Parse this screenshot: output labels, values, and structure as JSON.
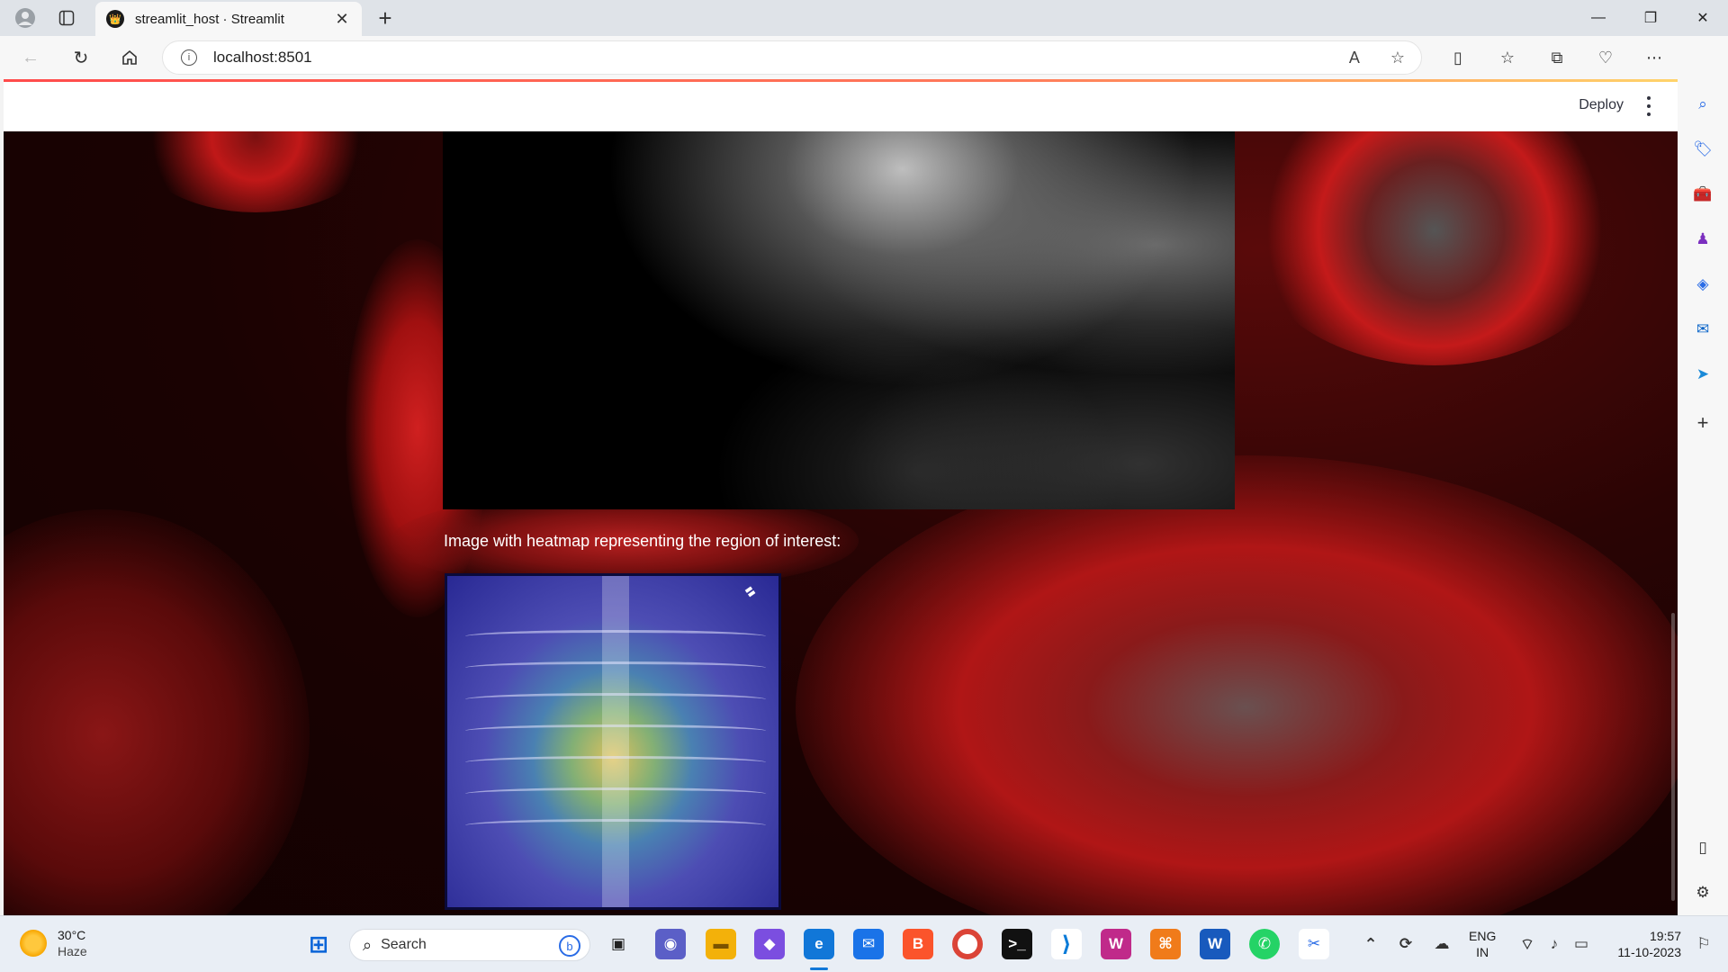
{
  "browser": {
    "tab_title": "streamlit_host · Streamlit",
    "url": "localhost:8501"
  },
  "page": {
    "deploy_label": "Deploy",
    "heatmap_caption": "Image with heatmap representing the region of interest:"
  },
  "taskbar": {
    "weather_temp": "30°C",
    "weather_desc": "Haze",
    "search_label": "Search",
    "lang_primary": "ENG",
    "lang_secondary": "IN",
    "time": "19:57",
    "date": "11-10-2023"
  },
  "colors": {
    "accent": "#ff4b4b",
    "background_dark": "#1a0202"
  },
  "icons": {
    "titlebar": [
      "profile-icon",
      "tab-actions-icon",
      "new-tab-icon",
      "minimize-icon",
      "restore-icon",
      "close-icon"
    ],
    "nav": [
      "back-icon",
      "refresh-icon",
      "home-icon",
      "site-info-icon",
      "read-aloud-icon",
      "favorite-star-icon",
      "split-screen-icon",
      "favorites-icon",
      "collections-icon",
      "browser-essentials-icon",
      "more-icon",
      "copilot-icon"
    ],
    "sidebar": [
      "search-icon",
      "shopping-icon",
      "tools-icon",
      "games-icon",
      "microsoft365-icon",
      "outlook-icon",
      "send-icon",
      "add-icon",
      "sidebar-toggle-icon",
      "settings-icon"
    ]
  }
}
